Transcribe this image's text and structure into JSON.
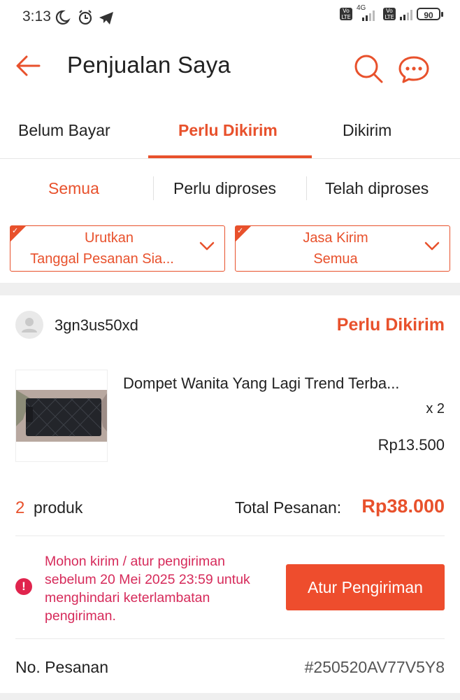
{
  "status_bar": {
    "time": "3:13",
    "network_label": "4G",
    "battery": "90"
  },
  "header": {
    "title": "Penjualan Saya"
  },
  "tabs": [
    {
      "label": "Belum Bayar"
    },
    {
      "label": "Perlu Dikirim"
    },
    {
      "label": "Dikirim"
    }
  ],
  "sub_tabs": [
    {
      "label": "Semua"
    },
    {
      "label": "Perlu diproses"
    },
    {
      "label": "Telah diproses"
    }
  ],
  "filters": {
    "sort": {
      "label": "Urutkan",
      "value": "Tanggal Pesanan Sia..."
    },
    "courier": {
      "label": "Jasa Kirim",
      "value": "Semua"
    }
  },
  "order": {
    "shop_name": "3gn3us50xd",
    "status": "Perlu Dikirim",
    "product_name": "Dompet Wanita Yang Lagi Trend Terba...",
    "quantity": "x 2",
    "price": "Rp13.500",
    "product_count": "2",
    "product_count_label": "produk",
    "total_label": "Total Pesanan:",
    "total_value": "Rp38.000",
    "warning_text": "Mohon kirim / atur pengiriman sebelum 20 Mei 2025 23:59 untuk menghindari keterlambatan pengiriman.",
    "ship_button": "Atur Pengiriman",
    "order_no_label": "No. Pesanan",
    "order_no_value": "#250520AV77V5Y8"
  },
  "colors": {
    "accent": "#ee4d2d",
    "warning": "#d62a5a"
  }
}
